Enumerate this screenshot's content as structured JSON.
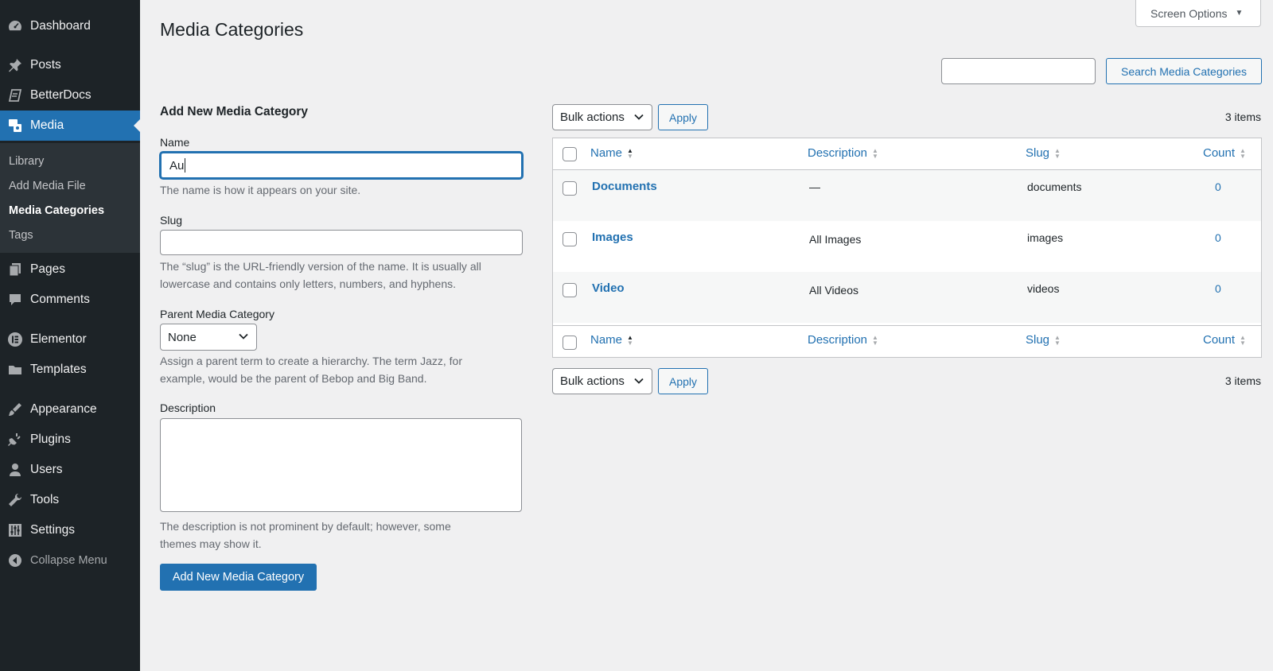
{
  "sidebar": {
    "items": [
      {
        "label": "Dashboard",
        "icon": "dashboard-icon"
      },
      {
        "label": "Posts",
        "icon": "pin-icon"
      },
      {
        "label": "BetterDocs",
        "icon": "docs-icon"
      },
      {
        "label": "Media",
        "icon": "media-icon"
      },
      {
        "label": "Pages",
        "icon": "pages-icon"
      },
      {
        "label": "Comments",
        "icon": "comment-icon"
      },
      {
        "label": "Elementor",
        "icon": "elementor-icon"
      },
      {
        "label": "Templates",
        "icon": "folder-icon"
      },
      {
        "label": "Appearance",
        "icon": "brush-icon"
      },
      {
        "label": "Plugins",
        "icon": "plug-icon"
      },
      {
        "label": "Users",
        "icon": "user-icon"
      },
      {
        "label": "Tools",
        "icon": "wrench-icon"
      },
      {
        "label": "Settings",
        "icon": "sliders-icon"
      }
    ],
    "media_submenu": [
      "Library",
      "Add Media File",
      "Media Categories",
      "Tags"
    ],
    "collapse_label": "Collapse Menu"
  },
  "screen_options": "Screen Options",
  "page_title": "Media Categories",
  "search": {
    "button": "Search Media Categories",
    "value": ""
  },
  "form": {
    "title": "Add New Media Category",
    "name_label": "Name",
    "name_value": "Au",
    "name_help": "The name is how it appears on your site.",
    "slug_label": "Slug",
    "slug_help_1": "The “slug” is the URL-friendly version of the name. It is usually all",
    "slug_help_2": "lowercase and contains only letters, numbers, and hyphens.",
    "parent_label": "Parent Media Category",
    "parent_value": "None",
    "parent_help_1": "Assign a parent term to create a hierarchy. The term Jazz, for",
    "parent_help_2": "example, would be the parent of Bebop and Big Band.",
    "desc_label": "Description",
    "desc_help_1": "The description is not prominent by default; however, some",
    "desc_help_2": "themes may show it.",
    "submit": "Add New Media Category"
  },
  "bulk": {
    "label": "Bulk actions",
    "apply": "Apply",
    "count": "3 items"
  },
  "table": {
    "columns": {
      "name": "Name",
      "description": "Description",
      "slug": "Slug",
      "count": "Count"
    },
    "rows": [
      {
        "name": "Documents",
        "description": "—",
        "slug": "documents",
        "count": "0"
      },
      {
        "name": "Images",
        "description": "All Images",
        "slug": "images",
        "count": "0"
      },
      {
        "name": "Video",
        "description": "All Videos",
        "slug": "videos",
        "count": "0"
      }
    ]
  },
  "colors": {
    "accent": "#2271b1",
    "sidebar_bg": "#1d2327",
    "page_bg": "#f0f0f1"
  }
}
